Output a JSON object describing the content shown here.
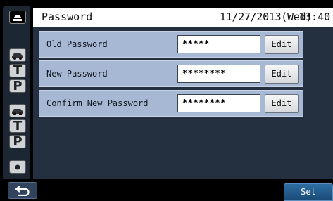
{
  "header": {
    "title": "Password",
    "date": "11/27/2013(Wed)",
    "time": "13:40"
  },
  "sidebar": {
    "icons": [
      "eject-icon",
      "car-icon",
      "t-letter",
      "p-letter",
      "car-icon",
      "t-letter",
      "p-letter",
      "dot-icon"
    ],
    "letters": {
      "t1": "T",
      "p1": "P",
      "t2": "T",
      "p2": "P"
    }
  },
  "form": {
    "rows": [
      {
        "label": "Old Password",
        "value": "*****",
        "button": "Edit"
      },
      {
        "label": "New Password",
        "value": "********",
        "button": "Edit"
      },
      {
        "label": "Confirm New Password",
        "value": "********",
        "button": "Edit"
      }
    ]
  },
  "footer": {
    "back_icon": "back-arrow-icon",
    "set_label": "Set"
  },
  "colors": {
    "row_bg": "#a6b8d3",
    "panel_bg": "#24303f",
    "set_button": "#2e6da1"
  }
}
